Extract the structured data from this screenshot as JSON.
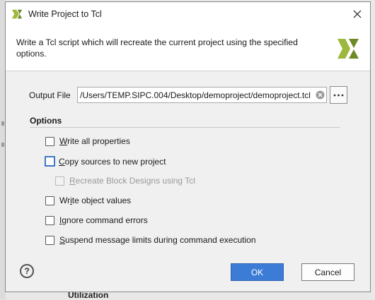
{
  "background": {
    "partial_text": "Utilization"
  },
  "dialog": {
    "title": "Write Project to Tcl",
    "description": "Write a Tcl script which will recreate the current project using the specified options.",
    "output_file": {
      "label": "Output File",
      "value": "/Users/TEMP.SIPC.004/Desktop/demoproject/demoproject.tcl"
    },
    "options_title": "Options",
    "options": [
      {
        "mnemonic": "W",
        "rest": "rite all properties",
        "checked": false,
        "enabled": true,
        "focused": false
      },
      {
        "mnemonic": "C",
        "rest": "opy sources to new project",
        "checked": false,
        "enabled": true,
        "focused": true
      },
      {
        "mnemonic": "R",
        "rest": "ecreate Block Designs using Tcl",
        "checked": false,
        "enabled": false,
        "focused": false
      },
      {
        "pre": "Wr",
        "mnemonic": "i",
        "rest": "te object values",
        "checked": false,
        "enabled": true,
        "focused": false
      },
      {
        "mnemonic": "I",
        "rest": "gnore command errors",
        "checked": false,
        "enabled": true,
        "focused": false
      },
      {
        "mnemonic": "S",
        "rest": "uspend message limits during command execution",
        "checked": false,
        "enabled": true,
        "focused": false
      }
    ],
    "help_label": "?",
    "ok_label": "OK",
    "cancel_label": "Cancel"
  },
  "colors": {
    "accent": "#3c7bd6",
    "logo_green": "#9cb83d",
    "logo_dark": "#6d8a24"
  },
  "icons": {
    "title": "vivado-logo-icon",
    "close": "close-icon",
    "header": "vivado-logo-icon",
    "clear": "clear-field-icon",
    "browse": "ellipsis-icon"
  }
}
